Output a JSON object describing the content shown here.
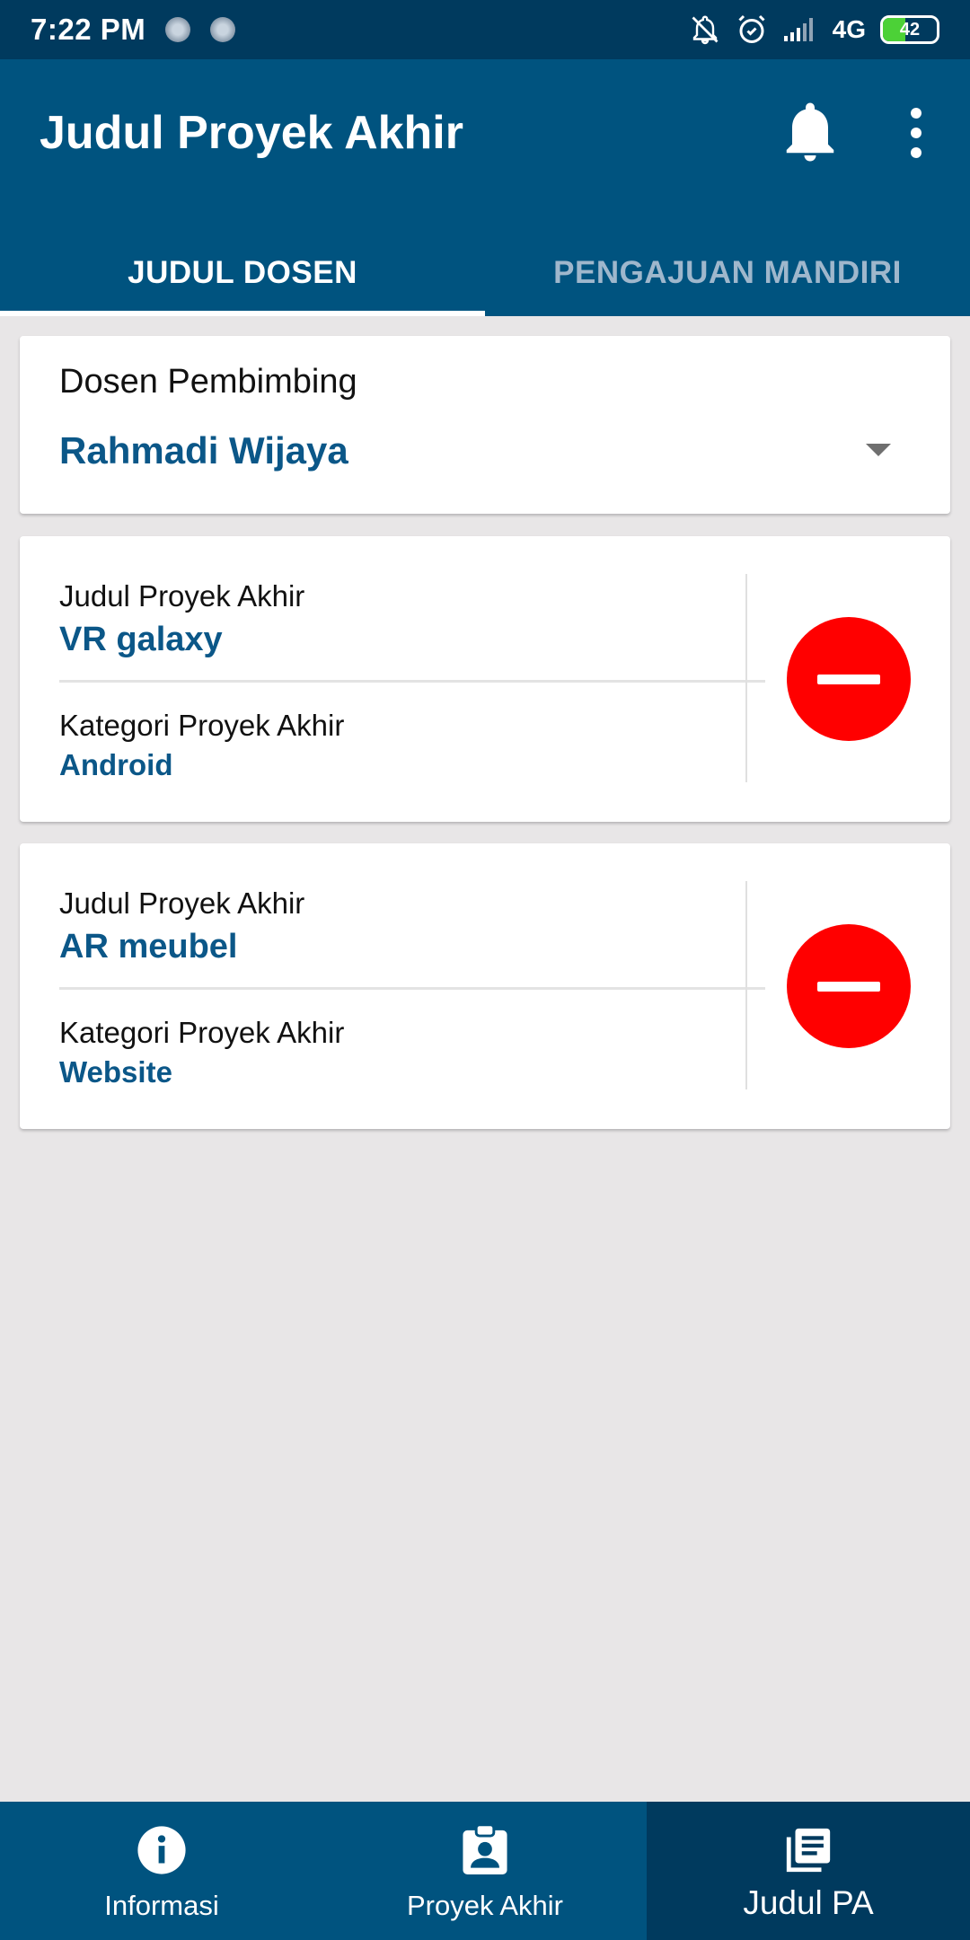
{
  "status_bar": {
    "time": "7:22 PM",
    "network": "4G",
    "battery": "42",
    "battery_level": 0.42,
    "icons": [
      "notifications-off-icon",
      "alarm-icon",
      "signal-icon"
    ]
  },
  "app_bar": {
    "title": "Judul Proyek Akhir",
    "actions": [
      "bell-icon",
      "more-vert-icon"
    ]
  },
  "tabs": [
    {
      "label": "JUDUL DOSEN",
      "active": true
    },
    {
      "label": "PENGAJUAN MANDIRI",
      "active": false
    }
  ],
  "dosen": {
    "label": "Dosen Pembimbing",
    "value": "Rahmadi Wijaya"
  },
  "projects": [
    {
      "title_label": "Judul Proyek Akhir",
      "title": "VR galaxy",
      "category_label": "Kategori Proyek Akhir",
      "category": "Android"
    },
    {
      "title_label": "Judul Proyek Akhir",
      "title": "AR meubel",
      "category_label": "Kategori Proyek Akhir",
      "category": "Website"
    }
  ],
  "bottom_nav": [
    {
      "label": "Informasi",
      "icon": "info-icon",
      "active": false
    },
    {
      "label": "Proyek Akhir",
      "icon": "badge-icon",
      "active": false
    },
    {
      "label": "Judul PA",
      "icon": "library-books-icon",
      "active": true
    }
  ],
  "colors": {
    "primary": "#00537f",
    "primary_dark": "#003a5e",
    "accent_text": "#0b5788",
    "remove": "#ff0000",
    "background": "#e8e6e7"
  }
}
